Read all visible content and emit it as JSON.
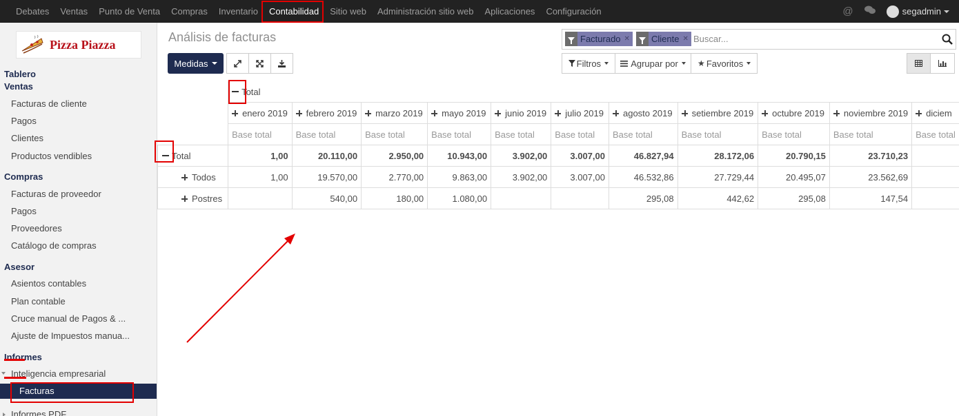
{
  "topbar": {
    "menu": [
      "Debates",
      "Ventas",
      "Punto de Venta",
      "Compras",
      "Inventario",
      "Contabilidad",
      "Sitio web",
      "Administración sitio web",
      "Aplicaciones",
      "Configuración"
    ],
    "active_index": 5,
    "user": "segadmin"
  },
  "sidebar": {
    "logo_text": "Pizza Piazza",
    "dashboard": "Tablero",
    "sales": {
      "title": "Ventas",
      "items": [
        "Facturas de cliente",
        "Pagos",
        "Clientes",
        "Productos vendibles"
      ]
    },
    "purchases": {
      "title": "Compras",
      "items": [
        "Facturas de proveedor",
        "Pagos",
        "Proveedores",
        "Catálogo de compras"
      ]
    },
    "adviser": {
      "title": "Asesor",
      "items": [
        "Asientos contables",
        "Plan contable",
        "Cruce manual de Pagos & ...",
        "Ajuste de Impuestos manua..."
      ]
    },
    "reports": {
      "title": "Informes",
      "bi": "Inteligencia empresarial",
      "active": "Facturas",
      "pdf": "Informes PDF"
    }
  },
  "main": {
    "title": "Análisis de facturas",
    "measures_label": "Medidas",
    "search": {
      "facets": [
        "Facturado",
        "Cliente"
      ],
      "placeholder": "Buscar..."
    },
    "filters_label": "Filtros",
    "groupby_label": "Agrupar por",
    "favorites_label": "Favoritos"
  },
  "pivot": {
    "col_total_label": "Total",
    "measure_label": "Base total",
    "months": [
      "enero 2019",
      "febrero 2019",
      "marzo 2019",
      "mayo 2019",
      "junio 2019",
      "julio 2019",
      "agosto 2019",
      "setiembre 2019",
      "octubre 2019",
      "noviembre 2019",
      "diciem"
    ],
    "rows": [
      {
        "label": "Total",
        "values": [
          "1,00",
          "20.110,00",
          "2.950,00",
          "10.943,00",
          "3.902,00",
          "3.007,00",
          "46.827,94",
          "28.172,06",
          "20.790,15",
          "23.710,23",
          ""
        ]
      },
      {
        "label": "Todos",
        "values": [
          "1,00",
          "19.570,00",
          "2.770,00",
          "9.863,00",
          "3.902,00",
          "3.007,00",
          "46.532,86",
          "27.729,44",
          "20.495,07",
          "23.562,69",
          ""
        ]
      },
      {
        "label": "Postres",
        "values": [
          "",
          "540,00",
          "180,00",
          "1.080,00",
          "",
          "",
          "295,08",
          "442,62",
          "295,08",
          "147,54",
          ""
        ]
      }
    ]
  }
}
